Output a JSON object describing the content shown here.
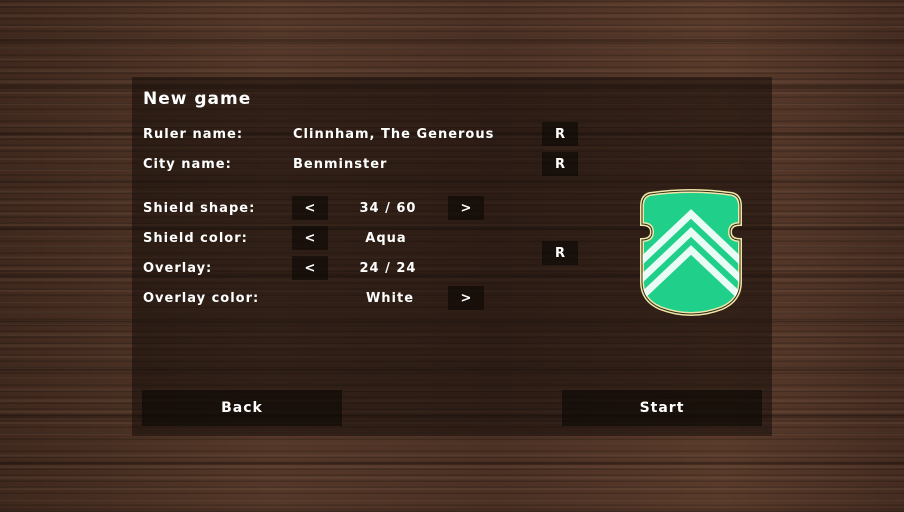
{
  "dialog": {
    "title": "New game",
    "ruler": {
      "label": "Ruler name:",
      "value": "Clinnham, The Generous",
      "random_label": "R"
    },
    "city": {
      "label": "City name:",
      "value": "Benminster",
      "random_label": "R"
    },
    "shield_shape": {
      "label": "Shield shape:",
      "value": "34 / 60",
      "prev": "<",
      "next": ">"
    },
    "shield_color": {
      "label": "Shield color:",
      "value": "Aqua",
      "prev": "<"
    },
    "overlay": {
      "label": "Overlay:",
      "value": "24 / 24",
      "prev": "<"
    },
    "overlay_color": {
      "label": "Overlay color:",
      "value": "White",
      "next": ">"
    },
    "shield_random_label": "R",
    "back_label": "Back",
    "start_label": "Start"
  },
  "colors": {
    "shield_fill": "#1fcf8a",
    "shield_border": "#f1e6a8",
    "overlay": "#ffffff"
  },
  "icons": {
    "shield_preview": "shield-chevron-icon"
  }
}
